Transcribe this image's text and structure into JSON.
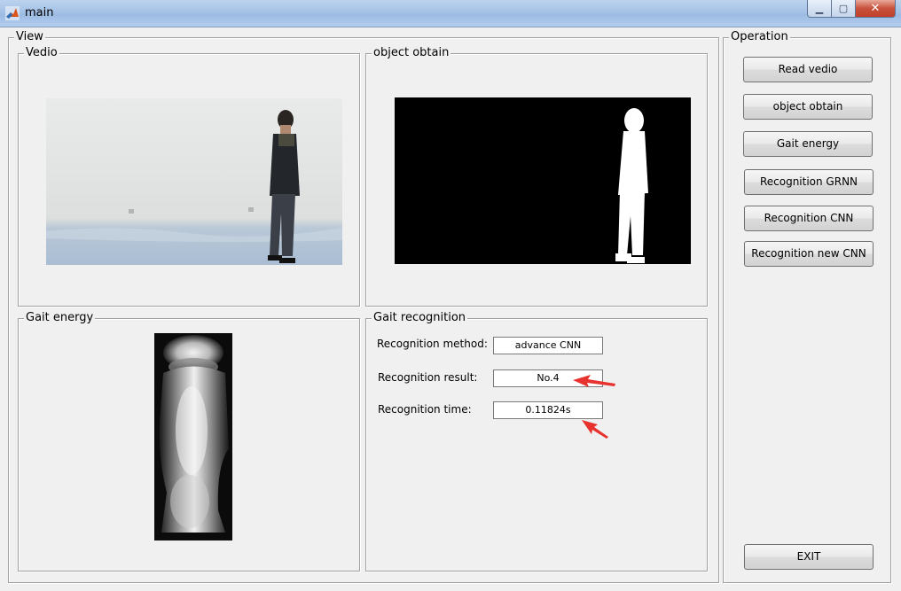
{
  "window": {
    "title": "main"
  },
  "view_panel": {
    "legend": "View",
    "video": {
      "legend": "Vedio"
    },
    "object": {
      "legend": "object obtain"
    },
    "gait_energy": {
      "legend": "Gait energy"
    },
    "gait_recognition": {
      "legend": "Gait recognition",
      "method_label": "Recognition method:",
      "method_value": "advance CNN",
      "result_label": "Recognition result:",
      "result_value": "No.4",
      "time_label": "Recognition time:",
      "time_value": "0.11824s"
    }
  },
  "operation_panel": {
    "legend": "Operation",
    "buttons": [
      "Read vedio",
      "object obtain",
      "Gait energy",
      "Recognition GRNN",
      "Recognition CNN",
      "Recognition new CNN"
    ],
    "exit_label": "EXIT"
  },
  "colors": {
    "annotation_arrow": "#e8322e"
  }
}
